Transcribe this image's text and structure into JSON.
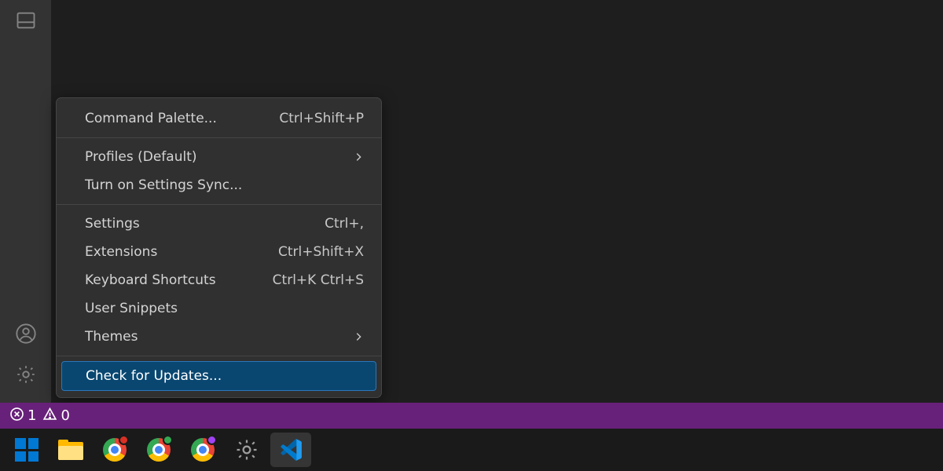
{
  "menu": {
    "items": [
      {
        "label": "Command Palette...",
        "shortcut": "Ctrl+Shift+P",
        "submenu": false,
        "sep_after": true
      },
      {
        "label": "Profiles (Default)",
        "shortcut": "",
        "submenu": true,
        "sep_after": false
      },
      {
        "label": "Turn on Settings Sync...",
        "shortcut": "",
        "submenu": false,
        "sep_after": true
      },
      {
        "label": "Settings",
        "shortcut": "Ctrl+,",
        "submenu": false,
        "sep_after": false
      },
      {
        "label": "Extensions",
        "shortcut": "Ctrl+Shift+X",
        "submenu": false,
        "sep_after": false
      },
      {
        "label": "Keyboard Shortcuts",
        "shortcut": "Ctrl+K Ctrl+S",
        "submenu": false,
        "sep_after": false
      },
      {
        "label": "User Snippets",
        "shortcut": "",
        "submenu": false,
        "sep_after": false
      },
      {
        "label": "Themes",
        "shortcut": "",
        "submenu": true,
        "sep_after": true
      },
      {
        "label": "Check for Updates...",
        "shortcut": "",
        "submenu": false,
        "highlight": true
      }
    ]
  },
  "status_bar": {
    "errors": "1",
    "warnings": "0"
  },
  "activity_bar": {
    "top_icons": [
      "panel-icon"
    ],
    "bottom_icons": [
      "account-icon",
      "gear-icon"
    ]
  },
  "taskbar": {
    "items": [
      {
        "name": "start-button",
        "kind": "windows"
      },
      {
        "name": "file-explorer",
        "kind": "explorer"
      },
      {
        "name": "chrome-1",
        "kind": "chrome",
        "badge": "#d93025"
      },
      {
        "name": "chrome-2",
        "kind": "chrome",
        "badge": "#34a853"
      },
      {
        "name": "chrome-3",
        "kind": "chrome",
        "badge": "#a142f4"
      },
      {
        "name": "settings-app",
        "kind": "gear"
      },
      {
        "name": "vscode-app",
        "kind": "vscode",
        "active": true
      }
    ]
  },
  "colors": {
    "statusbar": "#68217a",
    "menu_highlight": "#094771"
  }
}
